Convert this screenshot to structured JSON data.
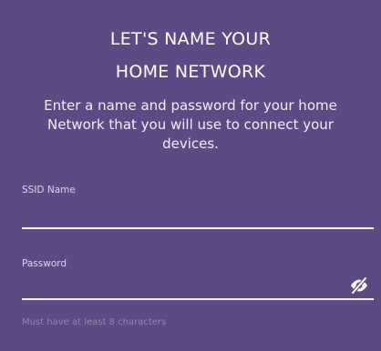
{
  "header": {
    "title_line1": "LET'S NAME YOUR",
    "title_line2": "HOME NETWORK",
    "subtitle": "Enter a name and password for your home Network that you will use to connect your devices."
  },
  "form": {
    "ssid": {
      "label": "SSID Name",
      "value": "",
      "placeholder": ""
    },
    "password": {
      "label": "Password",
      "value": "",
      "placeholder": "",
      "toggle_icon": "eye-slash-icon",
      "hint": "Must have at least 8 characters"
    }
  },
  "colors": {
    "background": "#5d4a84",
    "text": "#ffffff",
    "underline": "#f3f0f8",
    "hint": "#9486b2"
  }
}
